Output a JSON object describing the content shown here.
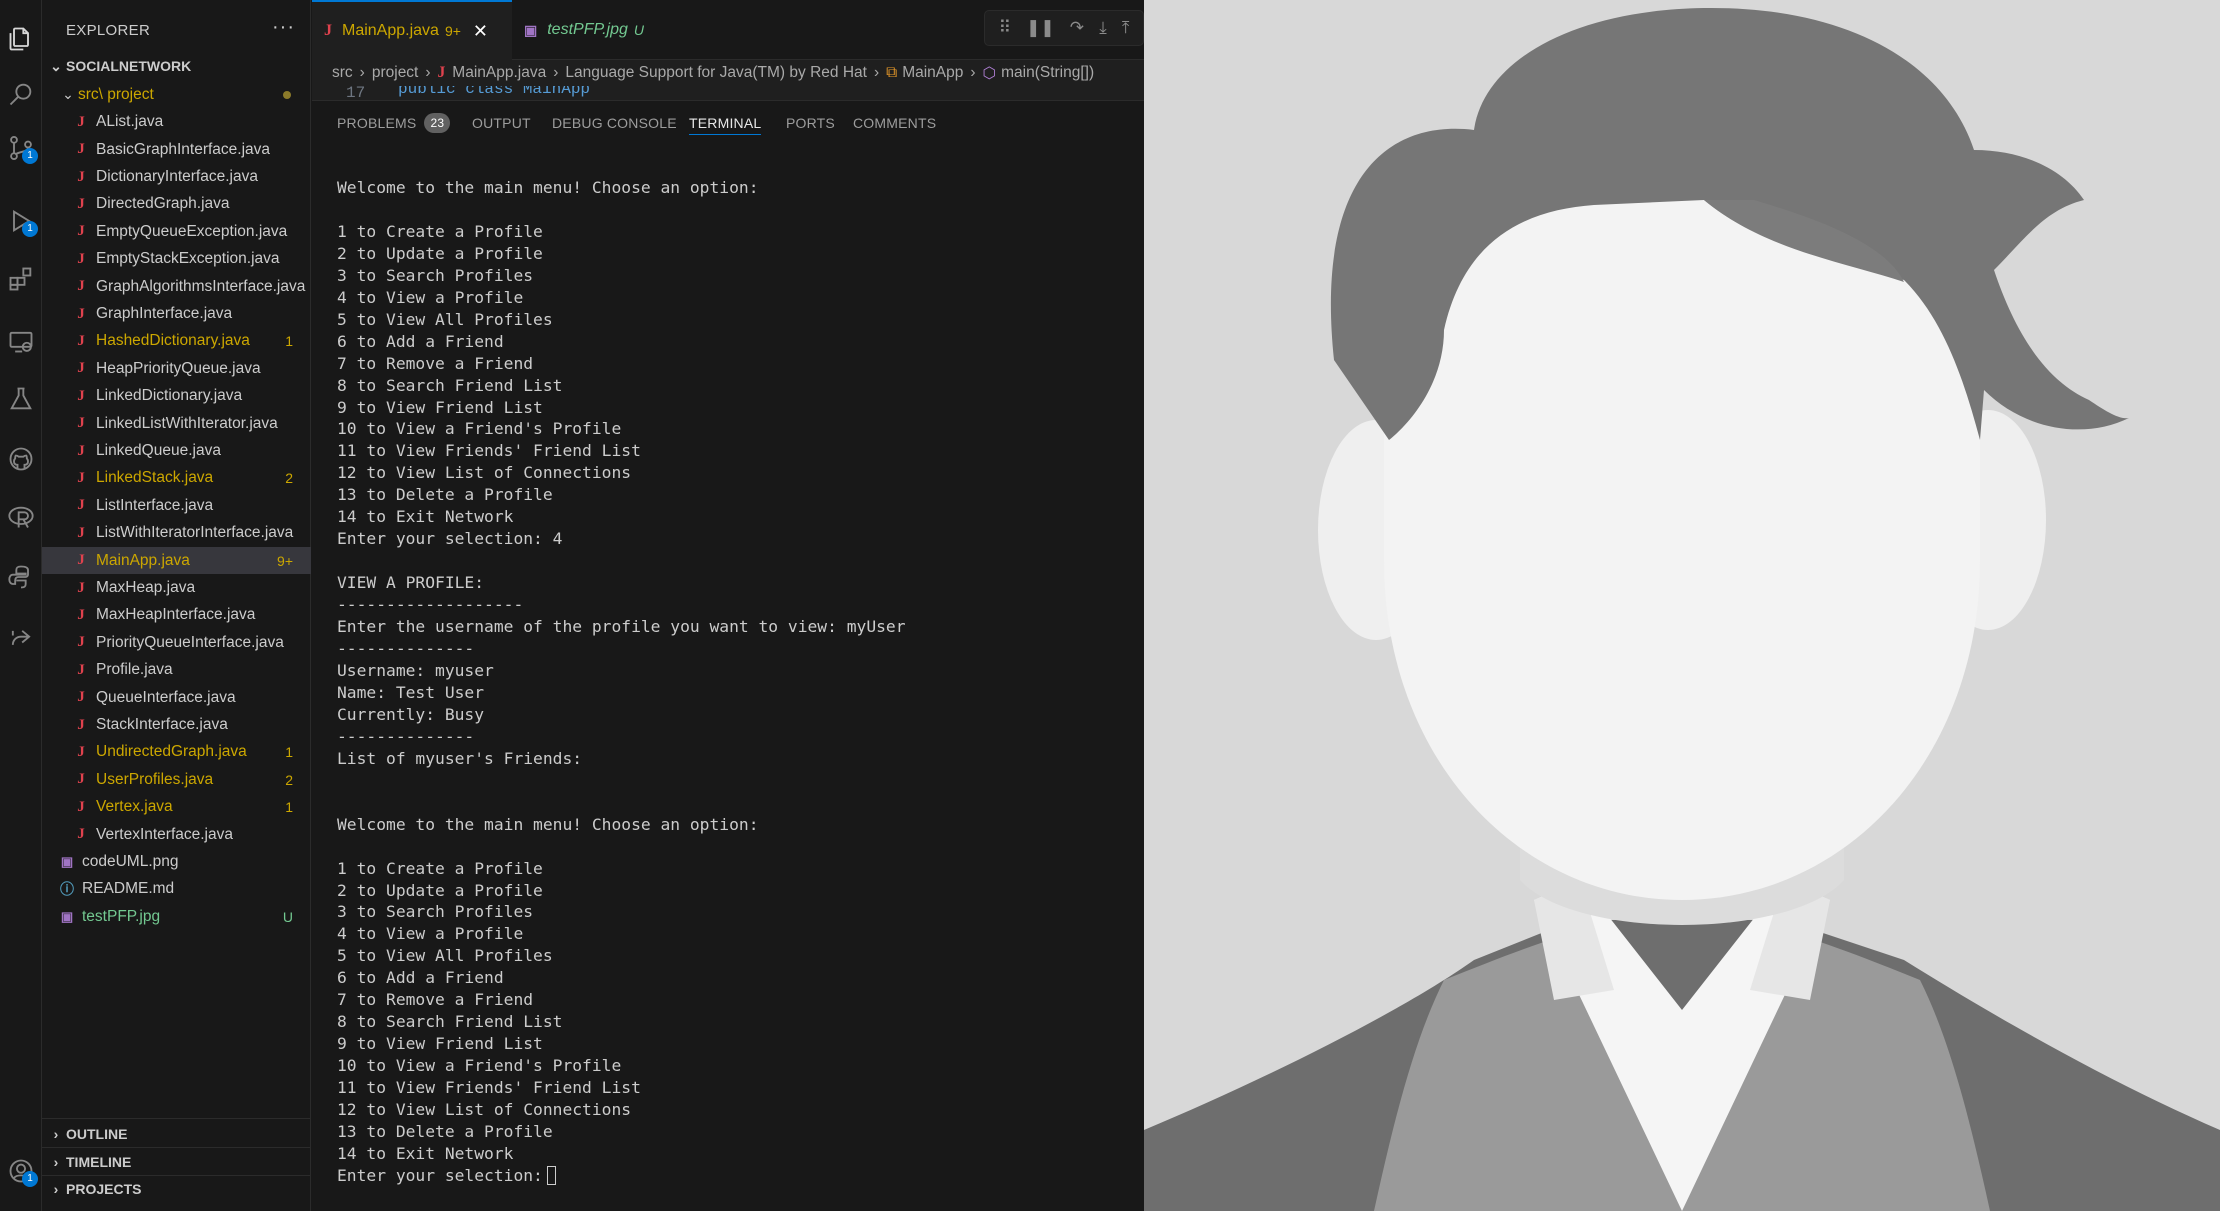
{
  "sidebar": {
    "title": "EXPLORER",
    "more": "···",
    "workspace": "SOCIALNETWORK",
    "folder": "src\\ project",
    "files": [
      {
        "name": "AList.java",
        "status": ""
      },
      {
        "name": "BasicGraphInterface.java",
        "status": ""
      },
      {
        "name": "DictionaryInterface.java",
        "status": ""
      },
      {
        "name": "DirectedGraph.java",
        "status": ""
      },
      {
        "name": "EmptyQueueException.java",
        "status": ""
      },
      {
        "name": "EmptyStackException.java",
        "status": ""
      },
      {
        "name": "GraphAlgorithmsInterface.java",
        "status": ""
      },
      {
        "name": "GraphInterface.java",
        "status": ""
      },
      {
        "name": "HashedDictionary.java",
        "status": "1"
      },
      {
        "name": "HeapPriorityQueue.java",
        "status": ""
      },
      {
        "name": "LinkedDictionary.java",
        "status": ""
      },
      {
        "name": "LinkedListWithIterator.java",
        "status": ""
      },
      {
        "name": "LinkedQueue.java",
        "status": ""
      },
      {
        "name": "LinkedStack.java",
        "status": "2"
      },
      {
        "name": "ListInterface.java",
        "status": ""
      },
      {
        "name": "ListWithIteratorInterface.java",
        "status": ""
      },
      {
        "name": "MainApp.java",
        "status": "9+"
      },
      {
        "name": "MaxHeap.java",
        "status": ""
      },
      {
        "name": "MaxHeapInterface.java",
        "status": ""
      },
      {
        "name": "PriorityQueueInterface.java",
        "status": ""
      },
      {
        "name": "Profile.java",
        "status": ""
      },
      {
        "name": "QueueInterface.java",
        "status": ""
      },
      {
        "name": "StackInterface.java",
        "status": ""
      },
      {
        "name": "UndirectedGraph.java",
        "status": "1"
      },
      {
        "name": "UserProfiles.java",
        "status": "2"
      },
      {
        "name": "Vertex.java",
        "status": "1"
      },
      {
        "name": "VertexInterface.java",
        "status": ""
      }
    ],
    "other_files": [
      {
        "name": "codeUML.png",
        "status": ""
      },
      {
        "name": "README.md",
        "status": ""
      },
      {
        "name": "testPFP.jpg",
        "status": "U"
      }
    ],
    "sections": [
      "OUTLINE",
      "TIMELINE",
      "PROJECTS"
    ]
  },
  "tabs": [
    {
      "label": "MainApp.java",
      "status": "9+",
      "close": "✕"
    },
    {
      "label": "testPFP.jpg",
      "status": "U"
    }
  ],
  "breadcrumb": {
    "src": "src",
    "project": "project",
    "file": "MainApp.java",
    "language": "Language Support for Java(TM) by Red Hat",
    "class": "MainApp",
    "method": "main(String[])"
  },
  "code_peek": {
    "line": "17",
    "text": "public class MainApp"
  },
  "panel": {
    "tabs": [
      "PROBLEMS",
      "OUTPUT",
      "DEBUG CONSOLE",
      "TERMINAL",
      "PORTS",
      "COMMENTS"
    ],
    "problems_count": "23",
    "active_tab": "TERMINAL"
  },
  "terminal": {
    "lines": [
      "Welcome to the main menu! Choose an option:",
      "",
      "1 to Create a Profile",
      "2 to Update a Profile",
      "3 to Search Profiles",
      "4 to View a Profile",
      "5 to View All Profiles",
      "6 to Add a Friend",
      "7 to Remove a Friend",
      "8 to Search Friend List",
      "9 to View Friend List",
      "10 to View a Friend's Profile",
      "11 to View Friends' Friend List",
      "12 to View List of Connections",
      "13 to Delete a Profile",
      "14 to Exit Network",
      "Enter your selection: 4",
      "",
      "VIEW A PROFILE:",
      "-------------------",
      "Enter the username of the profile you want to view: myUser",
      "--------------",
      "Username: myuser",
      "Name: Test User",
      "Currently: Busy",
      "--------------",
      "List of myuser's Friends:",
      "",
      "",
      "Welcome to the main menu! Choose an option:",
      "",
      "1 to Create a Profile",
      "2 to Update a Profile",
      "3 to Search Profiles",
      "4 to View a Profile",
      "5 to View All Profiles",
      "6 to Add a Friend",
      "7 to Remove a Friend",
      "8 to Search Friend List",
      "9 to View Friend List",
      "10 to View a Friend's Profile",
      "11 to View Friends' Friend List",
      "12 to View List of Connections",
      "13 to Delete a Profile",
      "14 to Exit Network"
    ],
    "prompt": "Enter your selection:"
  },
  "activity_badges": {
    "source_control": "1",
    "run_debug": "1",
    "accounts": "1"
  },
  "colors": {
    "accent": "#0078d4",
    "warning": "#cca700",
    "untracked": "#73c991",
    "java_icon": "#e0424e",
    "background": "#181818"
  },
  "icons": [
    "explorer-icon",
    "search-icon",
    "source-control-icon",
    "run-debug-icon",
    "extensions-icon",
    "remote-explorer-icon",
    "testing-icon",
    "github-icon",
    "r-icon",
    "python-icon",
    "live-share-icon",
    "accounts-icon"
  ]
}
